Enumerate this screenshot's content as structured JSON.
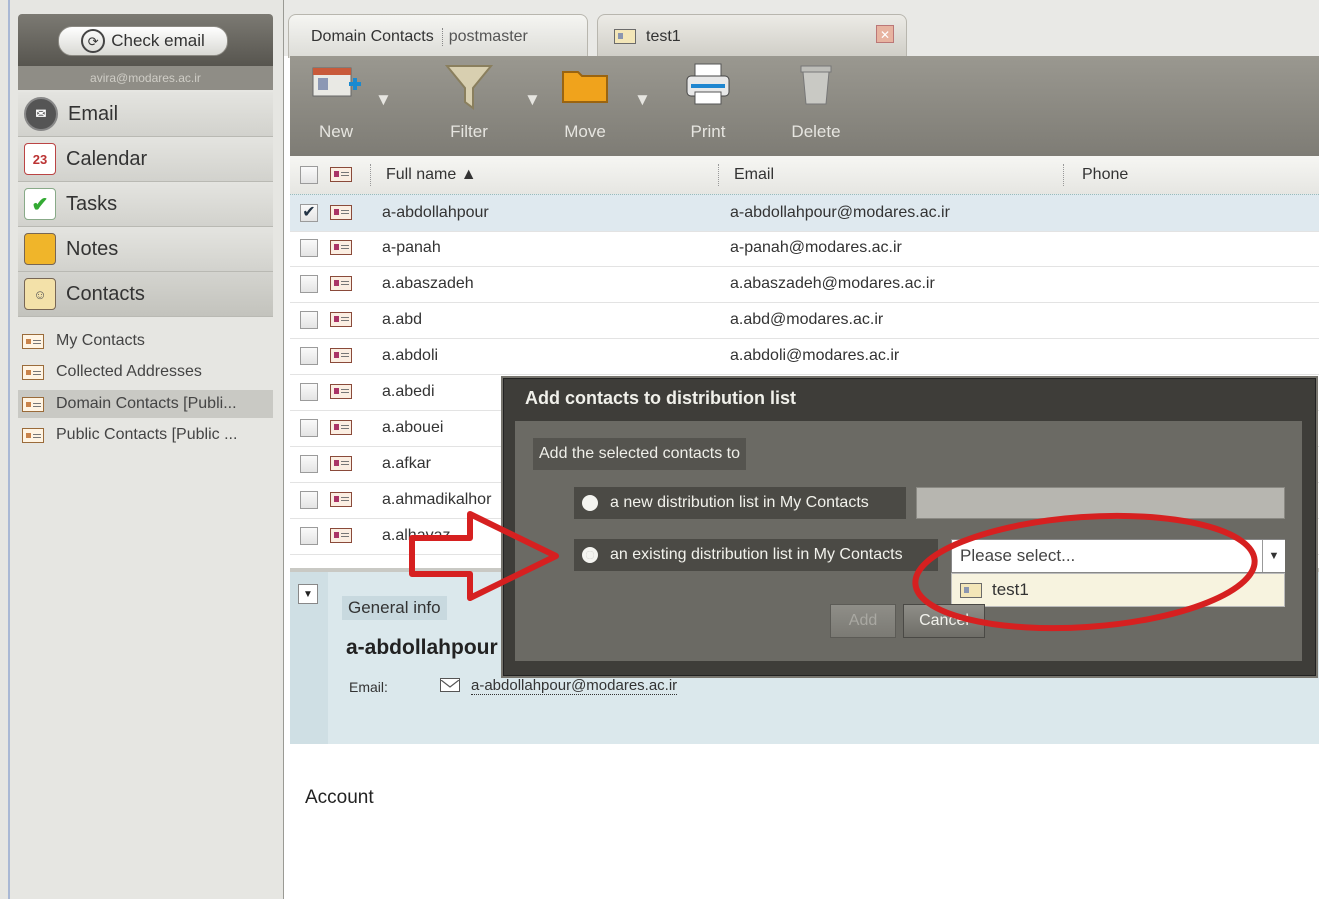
{
  "sidebar": {
    "check_email": "Check email",
    "user": "avira@modares.ac.ir",
    "nav": [
      {
        "label": "Email"
      },
      {
        "label": "Calendar",
        "badge": "23"
      },
      {
        "label": "Tasks"
      },
      {
        "label": "Notes"
      },
      {
        "label": "Contacts"
      }
    ],
    "folders": [
      {
        "label": "My Contacts"
      },
      {
        "label": "Collected Addresses"
      },
      {
        "label": "Domain Contacts [Publi..."
      },
      {
        "label": "Public Contacts [Public ..."
      }
    ]
  },
  "tabs": [
    {
      "label": "Domain Contacts",
      "sub": "postmaster"
    },
    {
      "label": "test1"
    }
  ],
  "toolbar": {
    "new": "New",
    "filter": "Filter",
    "move": "Move",
    "print": "Print",
    "delete": "Delete"
  },
  "grid": {
    "columns": {
      "fullname": "Full name ▲",
      "email": "Email",
      "phone": "Phone"
    },
    "rows": [
      {
        "name": "a-abdollahpour",
        "email": "a-abdollahpour@modares.ac.ir",
        "checked": true
      },
      {
        "name": "a-panah",
        "email": "a-panah@modares.ac.ir"
      },
      {
        "name": "a.abaszadeh",
        "email": "a.abaszadeh@modares.ac.ir"
      },
      {
        "name": "a.abd",
        "email": "a.abd@modares.ac.ir"
      },
      {
        "name": "a.abdoli",
        "email": "a.abdoli@modares.ac.ir"
      },
      {
        "name": "a.abedi",
        "email": ""
      },
      {
        "name": "a.abouei",
        "email": ""
      },
      {
        "name": "a.afkar",
        "email": ""
      },
      {
        "name": "a.ahmadikalhor",
        "email": ""
      },
      {
        "name": "a.alhavaz",
        "email": ""
      }
    ]
  },
  "detail": {
    "section": "General info",
    "name": "a-abdollahpour",
    "email_label": "Email:",
    "email": "a-abdollahpour@modares.ac.ir",
    "account": "Account"
  },
  "dialog": {
    "title": "Add contacts to distribution list",
    "subtitle": "Add the selected contacts to",
    "option_new": "a new distribution list in My Contacts",
    "option_existing": "an existing distribution list in My Contacts",
    "select_placeholder": "Please select...",
    "dropdown_item": "test1",
    "add": "Add",
    "cancel": "Cancel"
  },
  "colors": {
    "annotation": "#d62020",
    "accent": "#3a7bd5"
  }
}
